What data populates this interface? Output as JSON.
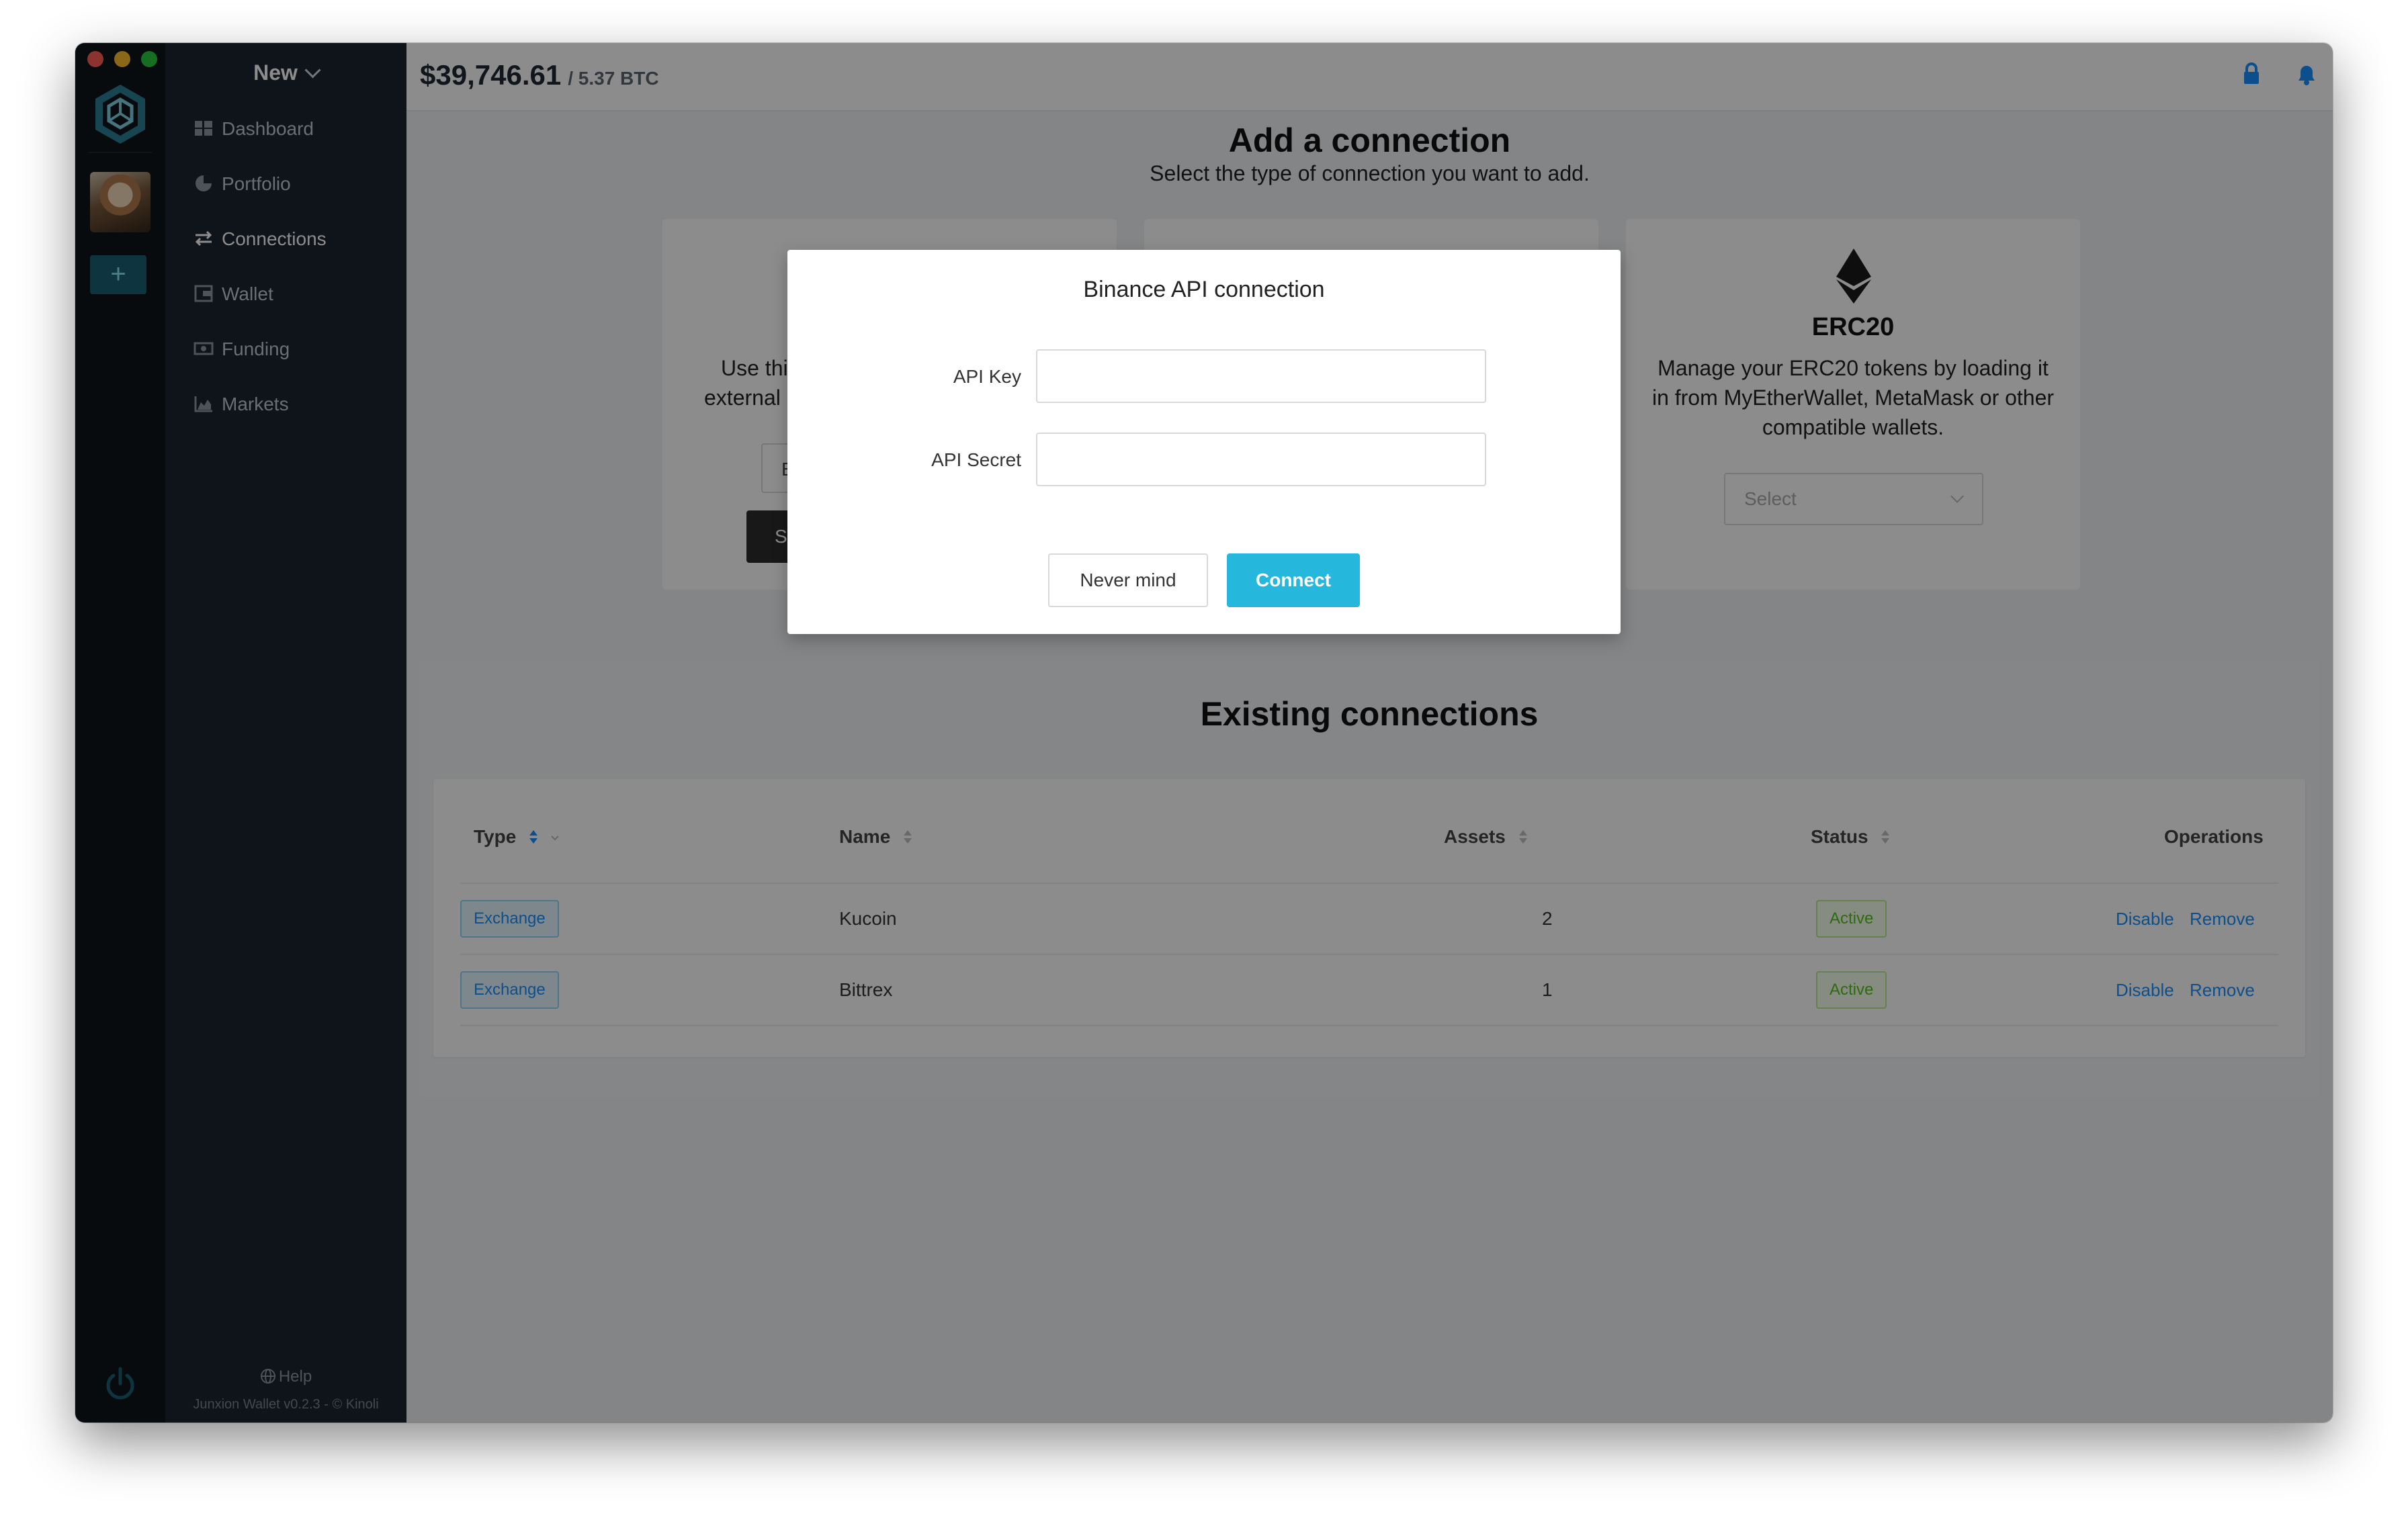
{
  "header": {
    "balance_usd": "$39,746.61",
    "balance_btc": "/ 5.37 BTC"
  },
  "sidebar": {
    "new_label": "New",
    "items": [
      {
        "label": "Dashboard",
        "icon": "dashboard-icon"
      },
      {
        "label": "Portfolio",
        "icon": "pie-chart-icon"
      },
      {
        "label": "Connections",
        "icon": "swap-icon"
      },
      {
        "label": "Wallet",
        "icon": "wallet-icon"
      },
      {
        "label": "Funding",
        "icon": "money-icon"
      },
      {
        "label": "Markets",
        "icon": "area-chart-icon"
      }
    ],
    "help": "Help",
    "version": "Junxion Wallet v0.2.3 - © Kinoli"
  },
  "main": {
    "title": "Add a connection",
    "subtitle": "Select the type of connection you want to add.",
    "card1": {
      "line1": "Use thi",
      "line2": "external (",
      "input_fragment": "E",
      "button_fragment": "S"
    },
    "erc20": {
      "title": "ERC20",
      "description": "Manage your ERC20 tokens by loading it in from MyEtherWallet, MetaMask or other compatible wallets.",
      "select_placeholder": "Select"
    },
    "existing": {
      "title": "Existing connections",
      "columns": {
        "type": "Type",
        "name": "Name",
        "assets": "Assets",
        "status": "Status",
        "operations": "Operations"
      },
      "rows": [
        {
          "type": "Exchange",
          "name": "Kucoin",
          "assets": "2",
          "status": "Active",
          "op1": "Disable",
          "op2": "Remove"
        },
        {
          "type": "Exchange",
          "name": "Bittrex",
          "assets": "1",
          "status": "Active",
          "op1": "Disable",
          "op2": "Remove"
        }
      ]
    }
  },
  "modal": {
    "title": "Binance API connection",
    "api_key_label": "API Key",
    "api_key_value": "",
    "api_secret_label": "API Secret",
    "api_secret_value": "",
    "cancel_label": "Never mind",
    "connect_label": "Connect"
  },
  "colors": {
    "accent": "#26b8dc",
    "sidebar_bg": "#1d2430",
    "rail_bg": "#0f1419",
    "link": "#1890ff",
    "status_active": "#52c41a"
  }
}
